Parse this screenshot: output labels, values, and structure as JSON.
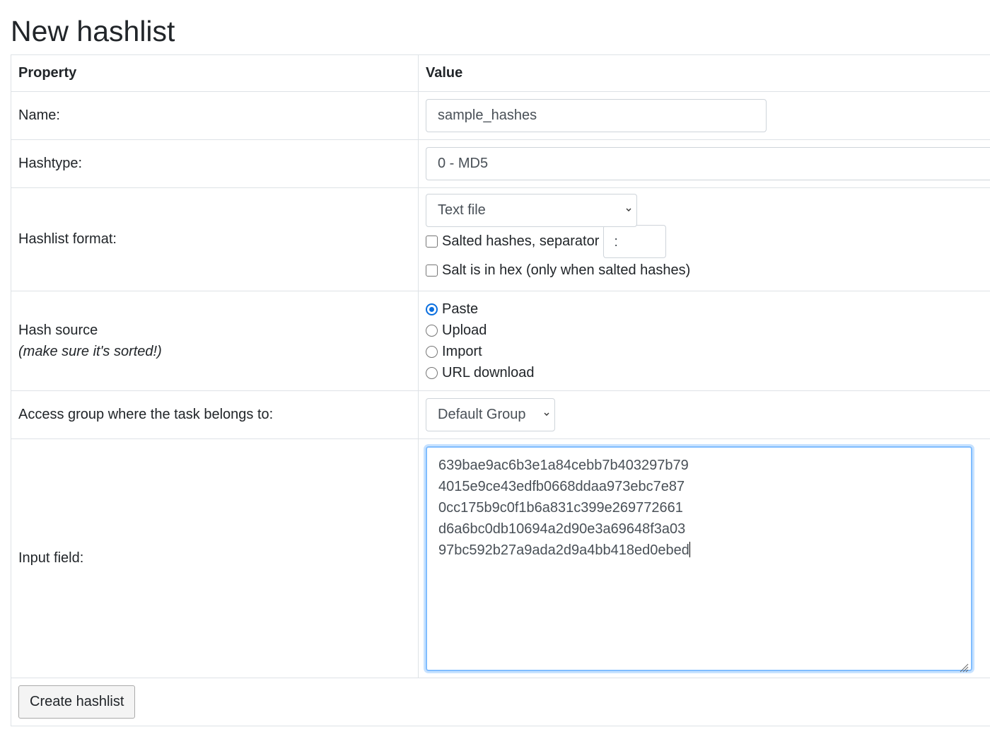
{
  "page_title": "New hashlist",
  "table": {
    "header_property": "Property",
    "header_value": "Value"
  },
  "name": {
    "label": "Name:",
    "value": "sample_hashes"
  },
  "hashtype": {
    "label": "Hashtype:",
    "value": "0 - MD5"
  },
  "format": {
    "label": "Hashlist format:",
    "selected": "Text file",
    "salted_label": "Salted hashes, separator",
    "separator_value": ":",
    "salted_checked": false,
    "hex_label": "Salt is in hex (only when salted hashes)",
    "hex_checked": false
  },
  "source": {
    "label": "Hash source",
    "hint": "(make sure it's sorted!)",
    "options": [
      "Paste",
      "Upload",
      "Import",
      "URL download"
    ],
    "selected": "Paste"
  },
  "access_group": {
    "label": "Access group where the task belongs to:",
    "selected": "Default Group"
  },
  "input_field": {
    "label": "Input field:",
    "lines": [
      "639bae9ac6b3e1a84cebb7b403297b79",
      "4015e9ce43edfb0668ddaa973ebc7e87",
      "0cc175b9c0f1b6a831c399e269772661",
      "d6a6bc0db10694a2d90e3a69648f3a03",
      "97bc592b27a9ada2d9a4bb418ed0ebed"
    ]
  },
  "submit": {
    "label": "Create hashlist"
  },
  "colors": {
    "accent": "#0b6fdf",
    "focus_border": "#80bdff",
    "border": "#dee2e6"
  }
}
